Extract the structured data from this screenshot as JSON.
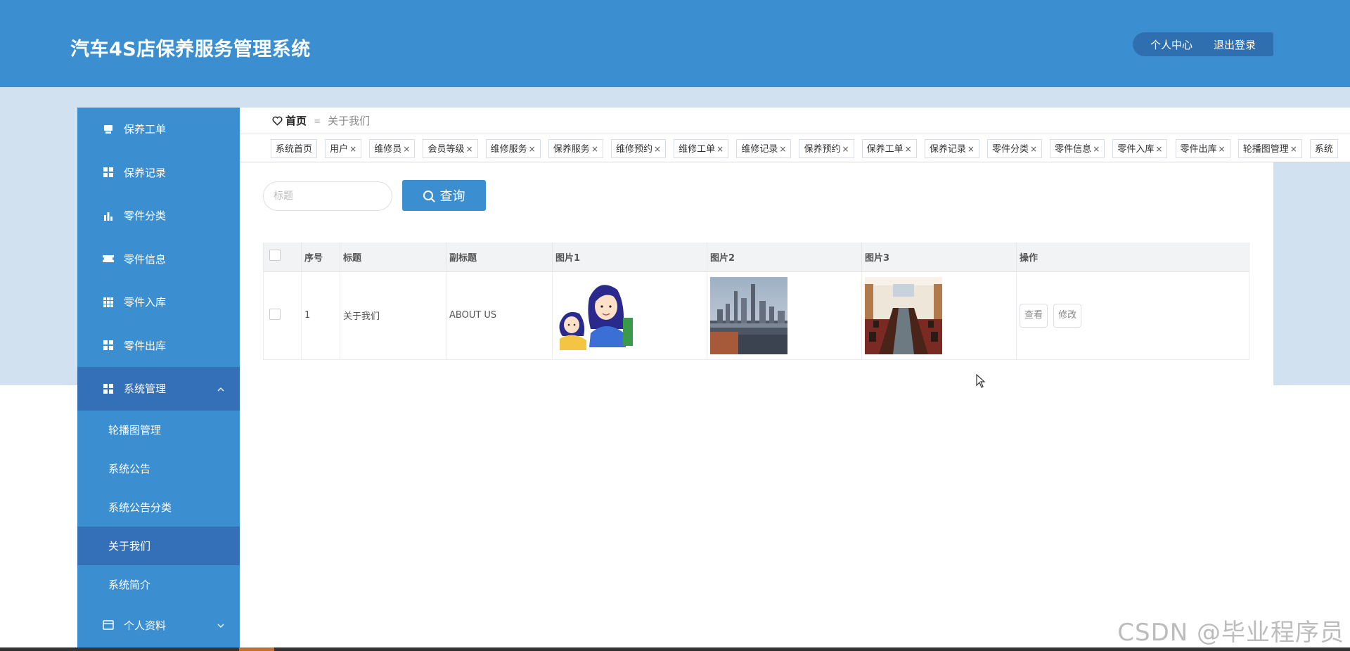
{
  "header": {
    "app_title": "汽车4S店保养服务管理系统",
    "profile_label": "个人中心",
    "logout_label": "退出登录"
  },
  "sidebar": {
    "items": [
      {
        "label": "保养工单",
        "icon": "document-icon"
      },
      {
        "label": "保养记录",
        "icon": "grid-icon"
      },
      {
        "label": "零件分类",
        "icon": "bar-chart-icon"
      },
      {
        "label": "零件信息",
        "icon": "ticket-icon"
      },
      {
        "label": "零件入库",
        "icon": "grid-icon"
      },
      {
        "label": "零件出库",
        "icon": "grid-icon"
      }
    ],
    "system_menu": {
      "label": "系统管理",
      "icon": "grid-icon",
      "expanded": true,
      "children": [
        {
          "label": "轮播图管理",
          "active": false
        },
        {
          "label": "系统公告",
          "active": false
        },
        {
          "label": "系统公告分类",
          "active": false
        },
        {
          "label": "关于我们",
          "active": true
        },
        {
          "label": "系统简介",
          "active": false
        }
      ]
    },
    "profile_menu": {
      "label": "个人资料",
      "icon": "profile-card-icon"
    }
  },
  "breadcrumb": {
    "home": "首页",
    "separator": "≡",
    "current": "关于我们"
  },
  "tags": [
    {
      "label": "系统首页",
      "closable": false
    },
    {
      "label": "用户",
      "closable": true
    },
    {
      "label": "维修员",
      "closable": true
    },
    {
      "label": "会员等级",
      "closable": true
    },
    {
      "label": "维修服务",
      "closable": true
    },
    {
      "label": "保养服务",
      "closable": true
    },
    {
      "label": "维修预约",
      "closable": true
    },
    {
      "label": "维修工单",
      "closable": true
    },
    {
      "label": "维修记录",
      "closable": true
    },
    {
      "label": "保养预约",
      "closable": true
    },
    {
      "label": "保养工单",
      "closable": true
    },
    {
      "label": "保养记录",
      "closable": true
    },
    {
      "label": "零件分类",
      "closable": true
    },
    {
      "label": "零件信息",
      "closable": true
    },
    {
      "label": "零件入库",
      "closable": true
    },
    {
      "label": "零件出库",
      "closable": true
    },
    {
      "label": "轮播图管理",
      "closable": true
    },
    {
      "label": "系统",
      "closable": false
    }
  ],
  "search": {
    "placeholder": "标题",
    "value": "",
    "button_label": "查询"
  },
  "table": {
    "columns": [
      "序号",
      "标题",
      "副标题",
      "图片1",
      "图片2",
      "图片3",
      "操作"
    ],
    "rows": [
      {
        "index": "1",
        "title": "关于我们",
        "subtitle": "ABOUT US",
        "pic1": "cartoon-girls-image",
        "pic2": "city-skyline-image",
        "pic3": "meeting-room-image",
        "view_label": "查看",
        "edit_label": "修改"
      }
    ]
  },
  "watermark": "CSDN @毕业程序员",
  "colors": {
    "primary": "#3b8ed0",
    "primary_dark": "#3370b8",
    "band": "#d2e1ef"
  }
}
